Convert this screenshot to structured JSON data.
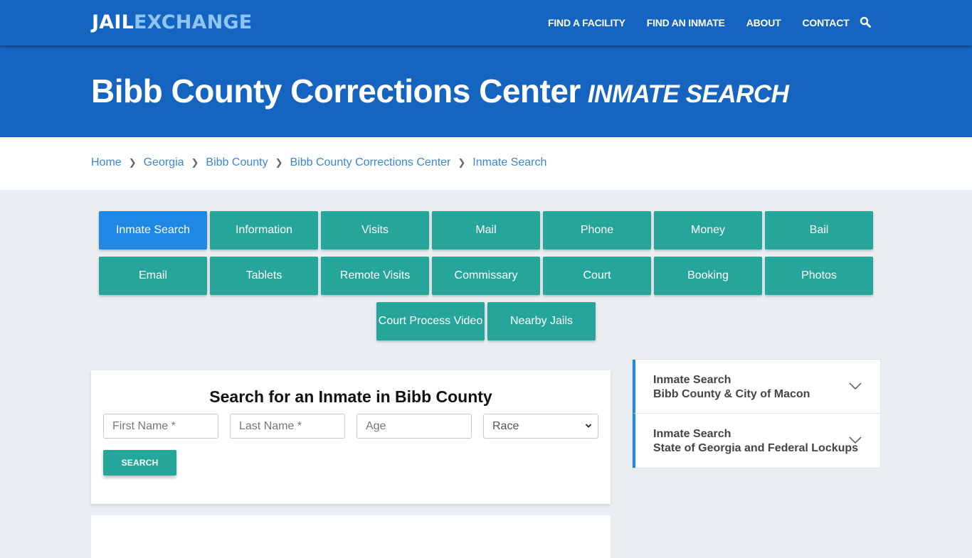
{
  "header": {
    "logo_part1": "JAIL",
    "logo_part2": "EXCHANGE",
    "nav": [
      {
        "label": "FIND A FACILITY"
      },
      {
        "label": "FIND AN INMATE"
      },
      {
        "label": "ABOUT"
      },
      {
        "label": "CONTACT"
      }
    ],
    "search_icon": "search-icon"
  },
  "hero": {
    "title": "Bibb County Corrections Center",
    "subtitle": "INMATE SEARCH"
  },
  "breadcrumb": [
    {
      "label": "Home"
    },
    {
      "label": "Georgia"
    },
    {
      "label": "Bibb County"
    },
    {
      "label": "Bibb County Corrections Center"
    },
    {
      "label": "Inmate Search"
    }
  ],
  "buttons": {
    "row1": [
      "Inmate Search",
      "Information",
      "Visits",
      "Mail",
      "Phone",
      "Money",
      "Bail"
    ],
    "row2": [
      "Email",
      "Tablets",
      "Remote Visits",
      "Commissary",
      "Court",
      "Booking",
      "Photos"
    ],
    "row3": [
      "Court Process Video",
      "Nearby Jails"
    ],
    "active": "Inmate Search"
  },
  "search_form": {
    "title": "Search for an Inmate in Bibb County",
    "first_name_placeholder": "First Name *",
    "last_name_placeholder": "Last Name *",
    "age_placeholder": "Age",
    "race_selected": "Race",
    "submit_label": "SEARCH"
  },
  "sidebar": {
    "items": [
      {
        "line1": "Inmate Search",
        "line2": "Bibb County & City of Macon"
      },
      {
        "line1": "Inmate Search",
        "line2": "State of Georgia and Federal Lockups"
      }
    ]
  },
  "colors": {
    "brand_blue": "#1565c0",
    "logo_light": "#8ec5f5",
    "teal": "#26a69a",
    "active_blue": "#1e88e5",
    "link_blue": "#3a86d4"
  }
}
